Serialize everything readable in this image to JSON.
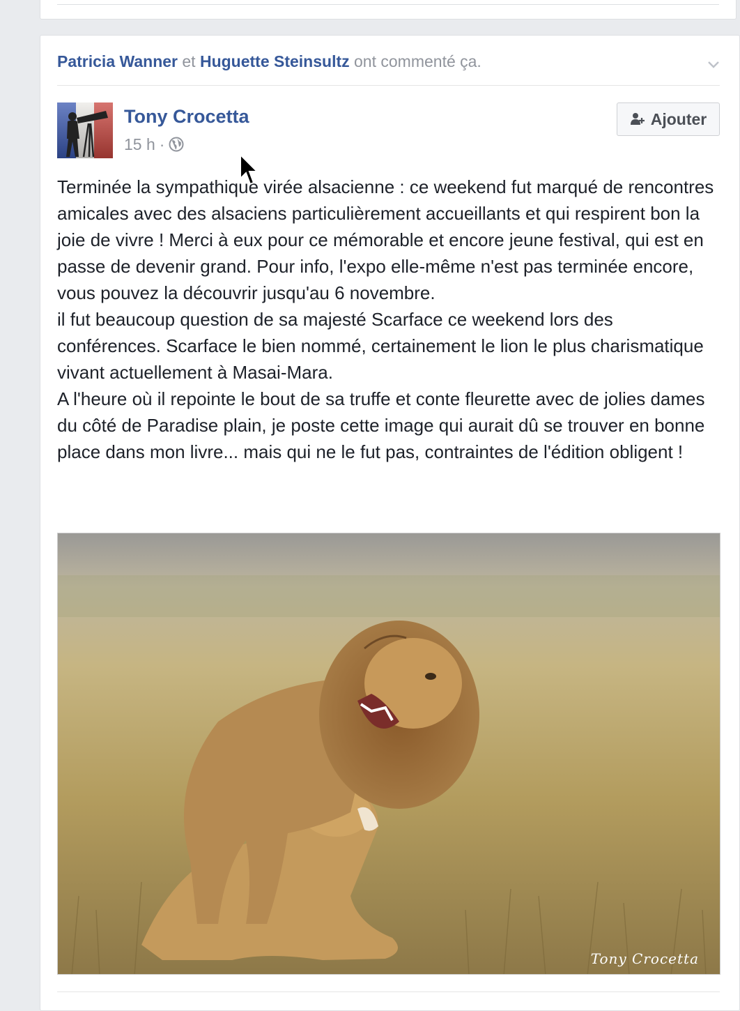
{
  "story": {
    "commenter_1": "Patricia Wanner",
    "joiner": "et",
    "commenter_2": "Huguette Steinsultz",
    "action": "ont commenté ça."
  },
  "post": {
    "author": "Tony Crocetta",
    "time": "15 h",
    "separator": "·",
    "add_label": "Ajouter",
    "paragraphs": [
      "Terminée la sympathique virée alsacienne : ce weekend fut marqué de rencontres amicales avec des alsaciens particulièrement accueillants et qui respirent bon la joie de vivre ! Merci à eux pour ce mémorable et encore jeune festival, qui est en passe de devenir grand. Pour info, l'expo elle-même n'est pas terminée encore, vous pouvez la découvrir jusqu'au 6 novembre.",
      "il fut beaucoup question de sa majesté Scarface ce weekend lors des conférences. Scarface le bien nommé, certainement le lion le plus charismatique vivant actuellement à Masai-Mara.",
      "A l'heure où il repointe le bout de sa truffe et conte fleurette avec de jolies dames du côté de Paradise plain, je poste cette image qui aurait dû se trouver en bonne place dans mon livre... mais qui ne le fut pas, contraintes de l'édition obligent !"
    ],
    "photo_watermark": "Tony Crocetta"
  },
  "colors": {
    "link": "#365899",
    "muted": "#90949c",
    "text": "#1d2129",
    "background": "#e9ebee"
  },
  "icons": [
    "chevron-down-icon",
    "globe-icon",
    "add-friend-icon",
    "cursor-icon"
  ]
}
